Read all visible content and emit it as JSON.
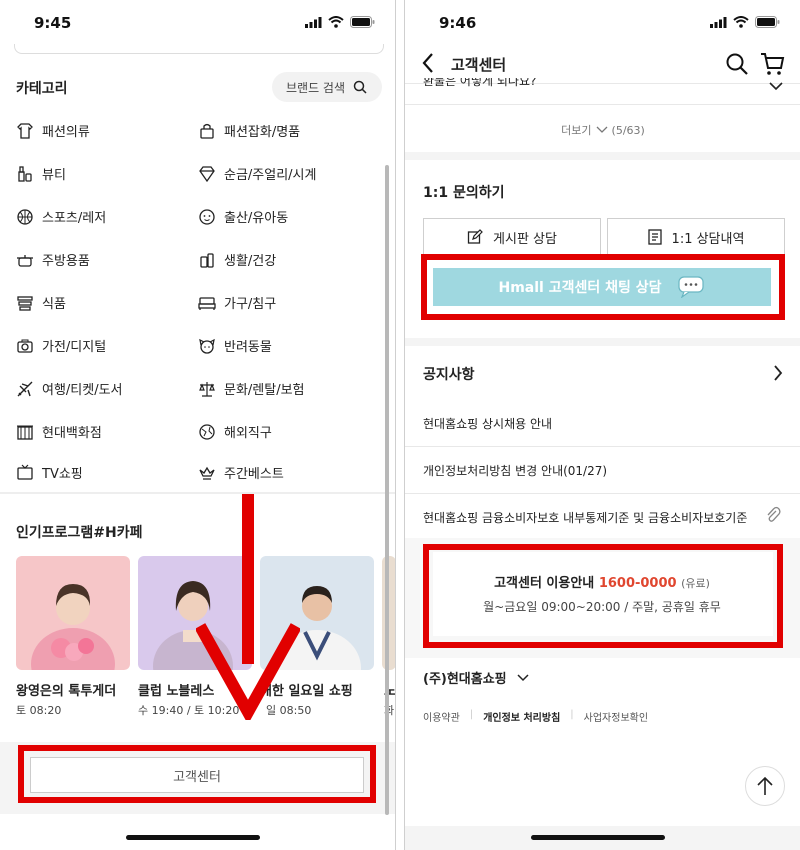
{
  "left": {
    "time": "9:45",
    "category_title": "카테고리",
    "brand_search": "브랜드 검색",
    "categories_left": [
      "패션의류",
      "뷰티",
      "스포츠/레저",
      "주방용품",
      "식품",
      "가전/디지털",
      "여행/티켓/도서",
      "현대백화점",
      "TV쇼핑"
    ],
    "categories_right": [
      "패션잡화/명품",
      "순금/주얼리/시계",
      "출산/유아동",
      "생활/건강",
      "가구/침구",
      "반려동물",
      "문화/렌탈/보험",
      "해외직구",
      "주간베스트"
    ],
    "program_title": "인기프로그램#H카페",
    "programs": [
      {
        "name": "왕영은의 톡투게더",
        "time": "토 08:20"
      },
      {
        "name": "클럽 노블레스",
        "time": "수 19:40 / 토 10:20"
      },
      {
        "name": "해한 일요일 쇼핑",
        "time": "일 08:50"
      },
      {
        "name": "노",
        "time": "화"
      }
    ],
    "customer_center": "고객센터"
  },
  "right": {
    "time": "9:46",
    "nav_title": "고객센터",
    "faq_cut_text": "환불은 어떻게 되나요?",
    "more_label": "더보기",
    "more_count": "(5/63)",
    "inquiry_title": "1:1 문의하기",
    "board_btn": "게시판 상담",
    "history_btn": "1:1 상담내역",
    "chat_btn": "Hmall 고객센터 채팅 상담",
    "notice_title": "공지사항",
    "notices": [
      "현대홈쇼핑 상시채용 안내",
      "개인정보처리방침 변경 안내(01/27)",
      "현대홈쇼핑 금융소비자보호 내부통제기준 및 금융소비자보호기준"
    ],
    "info_label": "고객센터 이용안내",
    "info_phone": "1600-0000",
    "info_paid": "(유료)",
    "info_hours": "월~금요일 09:00~20:00 / 주말, 공휴일 휴무",
    "company": "(주)현대홈쇼핑",
    "footer_links": [
      "이용약관",
      "개인정보 처리방침",
      "사업자정보확인"
    ]
  },
  "colors": {
    "highlight_red": "#e10000",
    "chat_bg": "#9fd8e0",
    "phone_accent": "#e0462f"
  }
}
